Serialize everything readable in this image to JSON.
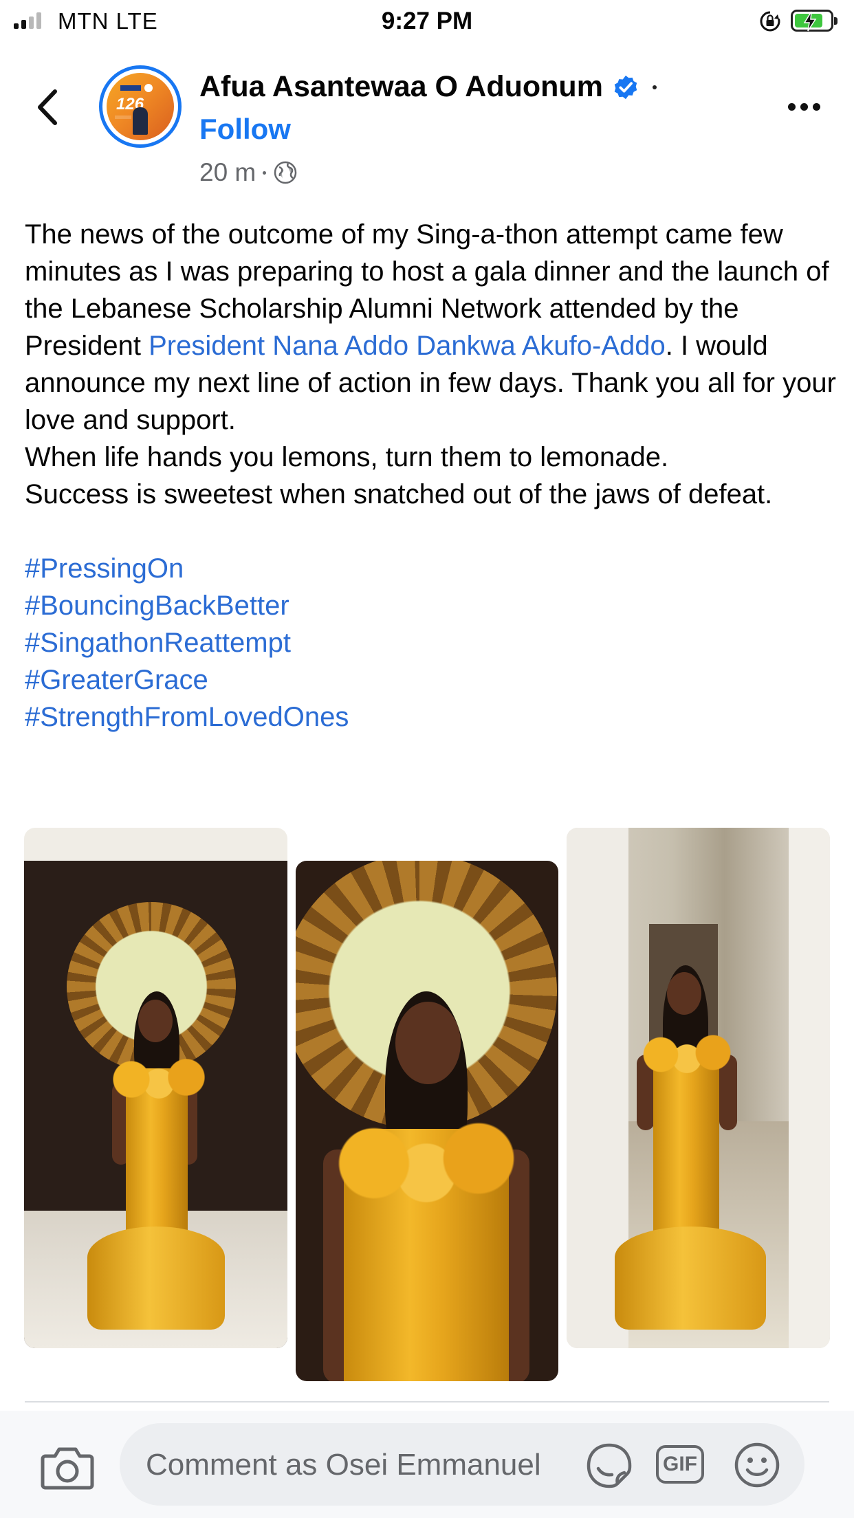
{
  "status_bar": {
    "carrier": "MTN  LTE",
    "time": "9:27 PM",
    "signal_bars": 4,
    "signal_bars_active": 2,
    "battery_charging": true,
    "icons": [
      "signal-icon",
      "orientation-lock-icon",
      "battery-charging-icon"
    ]
  },
  "header": {
    "back_icon": "chevron-left-icon",
    "author_name": "Afua Asantewaa O Aduonum",
    "verified": true,
    "follow_label": "Follow",
    "time_ago": "20 m",
    "audience_icon": "globe-icon",
    "more_icon": "ellipsis-icon"
  },
  "post": {
    "text_before_link": "The news of the outcome of my Sing-a-thon attempt came few minutes as I was preparing to host a gala dinner and the launch of the Lebanese Scholarship Alumni Network attended by the President ",
    "mention": "President Nana Addo Dankwa Akufo-Addo",
    "text_after_link": ". I would announce my next line of action in few days. Thank you all for your love and support.",
    "line2": "When life hands you lemons, turn them to lemonade.",
    "line3": "Success is sweetest when snatched out of the jaws of defeat.",
    "hashtags": [
      "#PressingOn",
      "#BouncingBackBetter",
      "#SingathonReattempt",
      "#GreaterGrace",
      "#StrengthFromLovedOnes"
    ],
    "photos_count": 3
  },
  "comment_bar": {
    "camera_icon": "camera-icon",
    "placeholder": "Comment as Osei Emmanuel",
    "sticker_icon": "sticker-icon",
    "gif_label": "GIF",
    "emoji_icon": "smile-icon"
  },
  "colors": {
    "accent": "#1877f2",
    "link": "#2b6cd4",
    "secondary_text": "#65676b",
    "dress_gold": "#f3b82a"
  }
}
